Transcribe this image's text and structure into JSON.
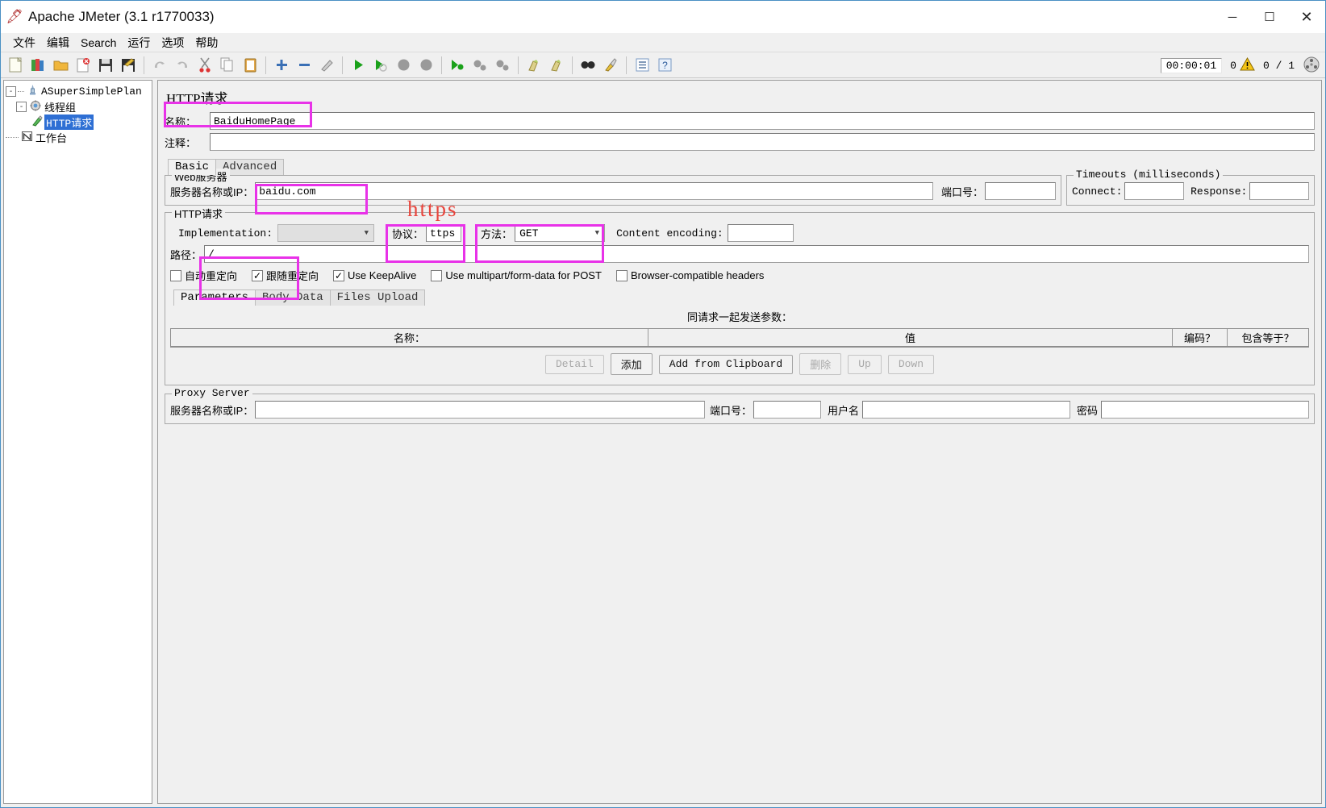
{
  "window": {
    "title": "Apache JMeter (3.1 r1770033)",
    "app_icon": "jmeter-feather-icon",
    "minimize": "─",
    "maximize": "☐",
    "close": "✕"
  },
  "menu": [
    "文件",
    "编辑",
    "Search",
    "运行",
    "选项",
    "帮助"
  ],
  "toolbar": {
    "buttons": [
      {
        "name": "new",
        "glyph": "🗋"
      },
      {
        "name": "templates",
        "glyph": "📚"
      },
      {
        "name": "open",
        "glyph": "📂"
      },
      {
        "name": "close",
        "glyph": "📄"
      },
      {
        "name": "save",
        "glyph": "💾"
      },
      {
        "name": "save-as",
        "glyph": "📝"
      },
      {
        "name": "undo",
        "glyph": "↩"
      },
      {
        "name": "redo",
        "glyph": "↪"
      },
      {
        "name": "cut",
        "glyph": "✂"
      },
      {
        "name": "copy",
        "glyph": "🗐"
      },
      {
        "name": "paste",
        "glyph": "📋"
      },
      {
        "name": "expand-all",
        "glyph": "✛"
      },
      {
        "name": "collapse-all",
        "glyph": "▬"
      },
      {
        "name": "toggle",
        "glyph": "🖉"
      },
      {
        "name": "start",
        "glyph": "▶"
      },
      {
        "name": "start-no-timers",
        "glyph": "▶"
      },
      {
        "name": "stop",
        "glyph": "⬤"
      },
      {
        "name": "shutdown",
        "glyph": "⬤"
      },
      {
        "name": "remote-start",
        "glyph": "▶"
      },
      {
        "name": "remote-stop",
        "glyph": "⬤"
      },
      {
        "name": "remote-shutdown",
        "glyph": "⬤"
      },
      {
        "name": "clear",
        "glyph": "🧹"
      },
      {
        "name": "clear-all",
        "glyph": "🧹"
      },
      {
        "name": "search",
        "glyph": "🔍"
      },
      {
        "name": "search-reset",
        "glyph": "🖌"
      },
      {
        "name": "function-helper",
        "glyph": "▤"
      },
      {
        "name": "help",
        "glyph": "?"
      }
    ],
    "timer": "00:00:01",
    "warning_count": "0",
    "warning_icon": "warning-triangle-icon",
    "thread_count": "0 / 1",
    "activity_icon": "remote-status-icon"
  },
  "tree": {
    "root": {
      "label": "ASuperSimplePlan",
      "icon": "test-plan-icon",
      "expander": "-"
    },
    "threadgroup": {
      "label": "线程组",
      "icon": "thread-group-icon",
      "expander": "-"
    },
    "httprequest": {
      "label": "HTTP请求",
      "icon": "http-sampler-icon",
      "selected": true
    },
    "workbench": {
      "label": "工作台",
      "icon": "workbench-icon"
    }
  },
  "panel": {
    "title": "HTTP请求",
    "name_label": "名称：",
    "name_value": "BaiduHomePage",
    "comment_label": "注释：",
    "comment_value": "",
    "tabs": [
      {
        "label": "Basic",
        "active": true
      },
      {
        "label": "Advanced",
        "active": false
      }
    ],
    "web_server": {
      "group_title": "Web服务器",
      "host_label": "服务器名称或IP：",
      "host_value": "baidu.com",
      "port_label": "端口号：",
      "port_value": ""
    },
    "timeouts": {
      "group_title": "Timeouts (milliseconds)",
      "connect_label": "Connect:",
      "connect_value": "",
      "response_label": "Response:",
      "response_value": ""
    },
    "http_request": {
      "group_title": "HTTP请求",
      "implementation_label": "Implementation:",
      "implementation_value": "",
      "protocol_label": "协议：",
      "protocol_value": "ttps",
      "method_label": "方法：",
      "method_value": "GET",
      "content_encoding_label": "Content encoding:",
      "content_encoding_value": "",
      "path_label": "路径：",
      "path_value": "/",
      "checkboxes": [
        {
          "label": "自动重定向",
          "checked": false,
          "mono": false
        },
        {
          "label": "跟随重定向",
          "checked": true,
          "mono": false
        },
        {
          "label": "Use KeepAlive",
          "checked": true,
          "mono": false
        },
        {
          "label": "Use multipart/form-data for POST",
          "checked": false,
          "mono": false
        },
        {
          "label": "Browser-compatible headers",
          "checked": false,
          "mono": false
        }
      ]
    },
    "params": {
      "tabs": [
        {
          "label": "Parameters",
          "active": true
        },
        {
          "label": "Body Data",
          "active": false
        },
        {
          "label": "Files Upload",
          "active": false
        }
      ],
      "send_label": "同请求一起发送参数：",
      "columns": [
        "名称：",
        "值",
        "编码？",
        "包含等于？"
      ],
      "rows": [],
      "buttons": [
        {
          "label": "Detail",
          "enabled": false,
          "cn": false
        },
        {
          "label": "添加",
          "enabled": true,
          "cn": true
        },
        {
          "label": "Add from Clipboard",
          "enabled": true,
          "cn": false
        },
        {
          "label": "删除",
          "enabled": false,
          "cn": true
        },
        {
          "label": "Up",
          "enabled": false,
          "cn": false
        },
        {
          "label": "Down",
          "enabled": false,
          "cn": false
        }
      ]
    },
    "proxy": {
      "group_title": "Proxy Server",
      "host_label": "服务器名称或IP：",
      "host_value": "",
      "port_label": "端口号：",
      "port_value": "",
      "user_label": "用户名",
      "user_value": "",
      "pass_label": "密码",
      "pass_value": ""
    }
  },
  "annotations": {
    "https_text": "https",
    "accent_color": "#e832e8",
    "note_color": "#e8443c"
  }
}
